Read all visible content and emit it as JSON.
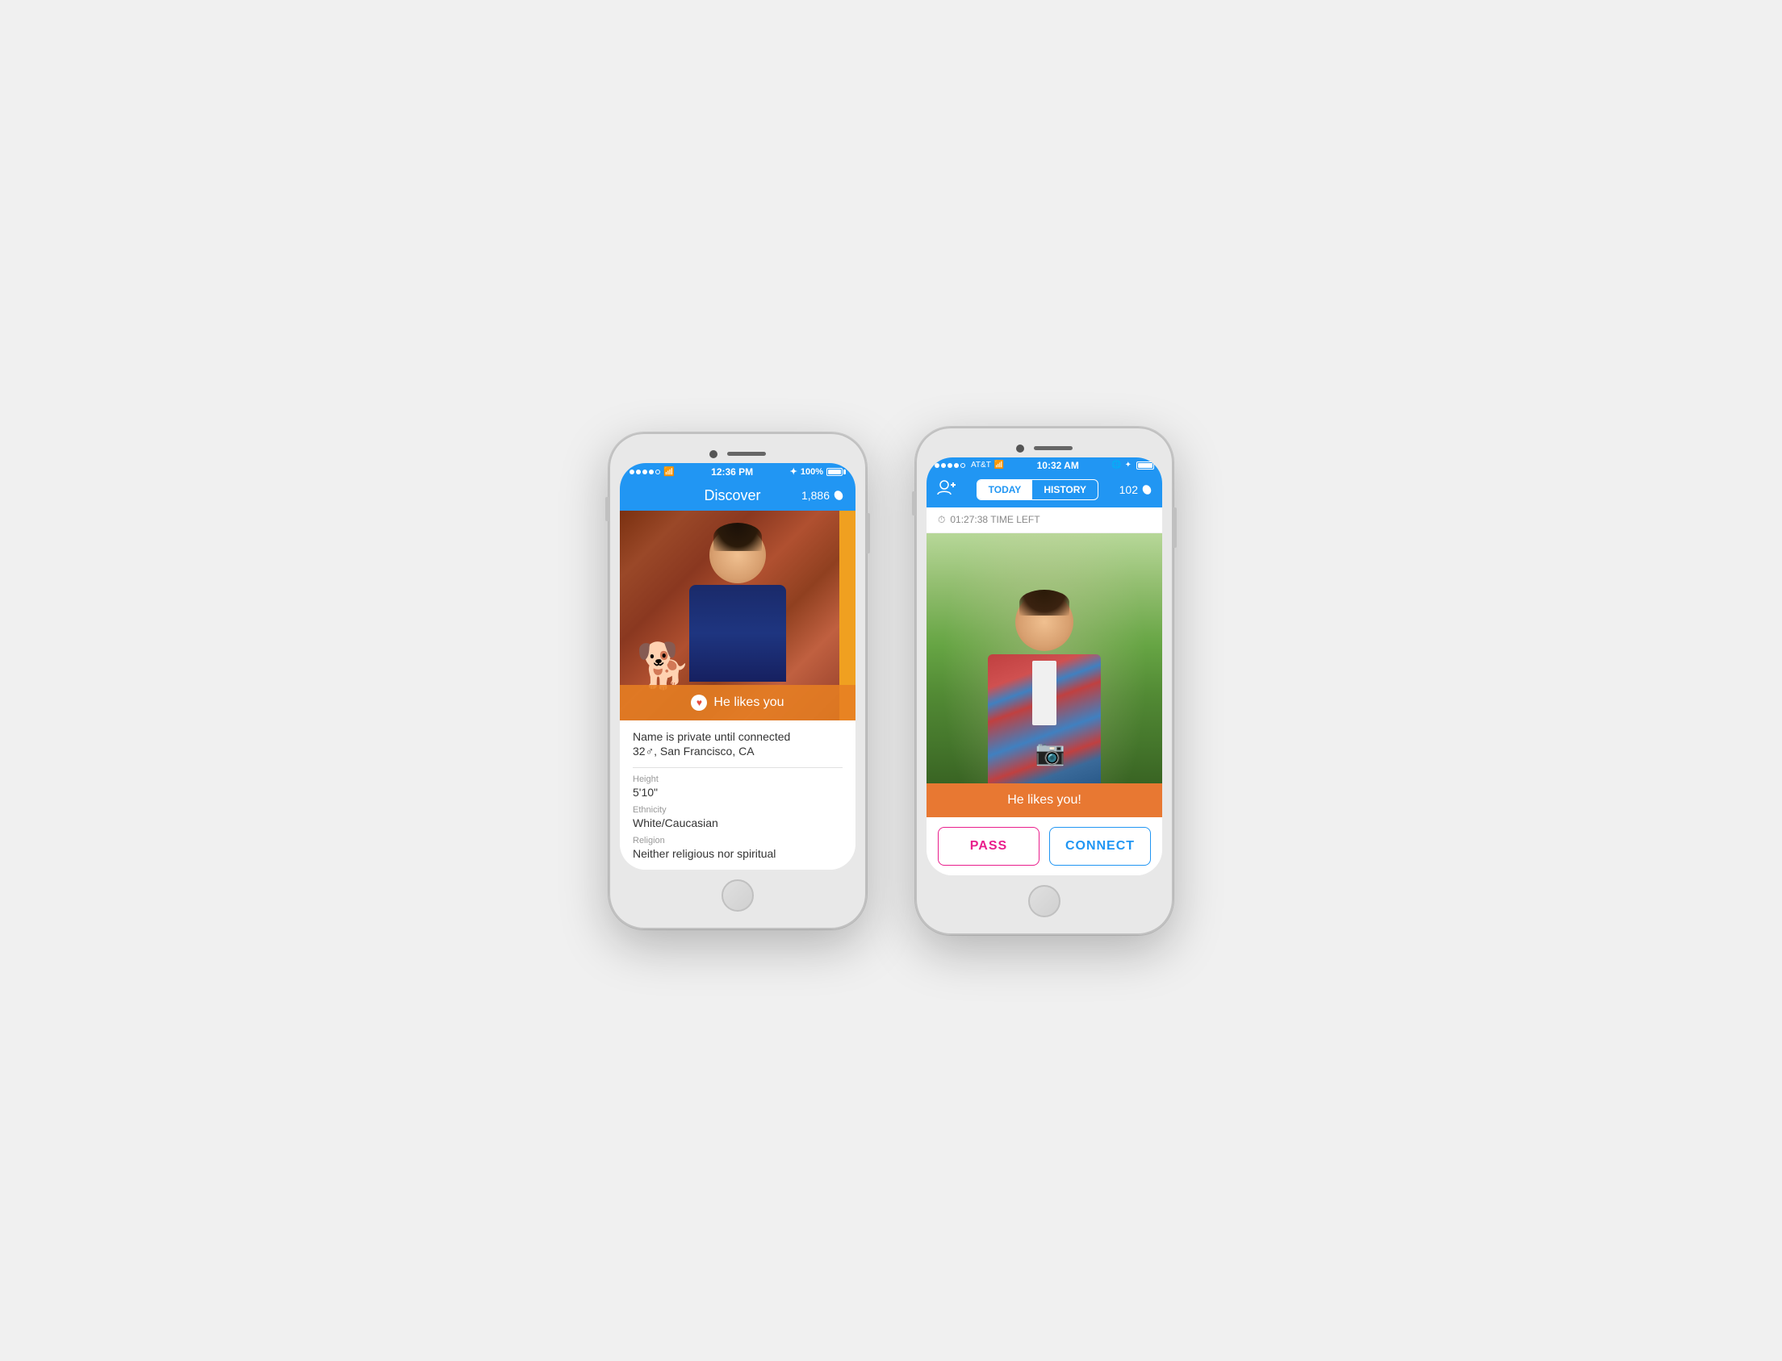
{
  "phone1": {
    "status": {
      "signal": "●●●●○",
      "wifi": "WiFi",
      "time": "12:36 PM",
      "bluetooth": "BT",
      "battery": "100%"
    },
    "navbar": {
      "title": "Discover",
      "count": "1,886",
      "icon": "leaf"
    },
    "profile": {
      "like_text": "He likes you",
      "name_line": "Name is private until connected",
      "age_location": "32♂, San Francisco, CA",
      "height_label": "Height",
      "height_value": "5'10\"",
      "ethnicity_label": "Ethnicity",
      "ethnicity_value": "White/Caucasian",
      "religion_label": "Religion",
      "religion_value": "Neither religious nor spiritual"
    }
  },
  "phone2": {
    "status": {
      "signal": "●●●●○",
      "carrier": "AT&T",
      "wifi": "WiFi",
      "time": "10:32 AM",
      "bluetooth": "BT",
      "battery": "■■■"
    },
    "navbar": {
      "tab_today": "TODAY",
      "tab_history": "HISTORY",
      "count": "102",
      "icon": "leaf"
    },
    "timer": {
      "clock_icon": "⏱",
      "time_left": "01:27:38 TIME LEFT"
    },
    "profile": {
      "like_text": "He likes you!"
    },
    "buttons": {
      "pass": "PASS",
      "connect": "CONNECT"
    }
  },
  "colors": {
    "blue": "#2196F3",
    "orange": "#E87832",
    "pink": "#e91e8c",
    "white": "#ffffff",
    "light_gray": "#f5f5f5",
    "text_gray": "#999999",
    "text_dark": "#333333"
  }
}
